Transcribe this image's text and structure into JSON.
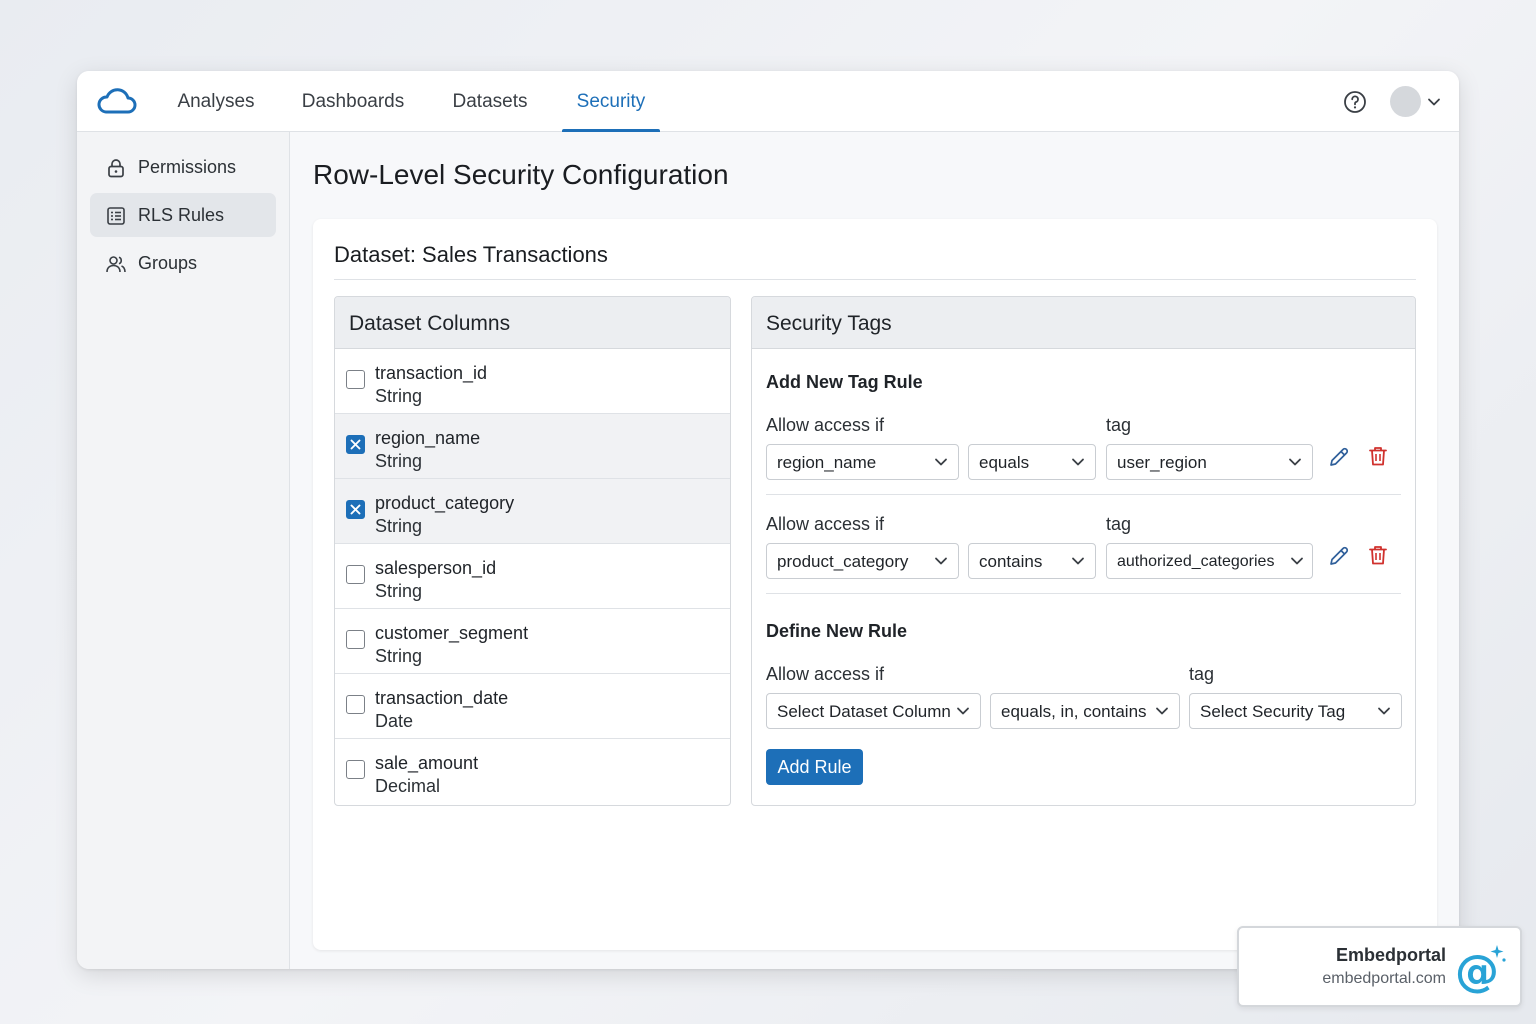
{
  "nav": {
    "tabs": [
      {
        "label": "Analyses"
      },
      {
        "label": "Dashboards"
      },
      {
        "label": "Datasets"
      },
      {
        "label": "Security",
        "active": true
      }
    ]
  },
  "sidebar": {
    "items": [
      {
        "label": "Permissions",
        "icon": "lock-icon"
      },
      {
        "label": "RLS Rules",
        "icon": "list-icon",
        "active": true
      },
      {
        "label": "Groups",
        "icon": "users-icon"
      }
    ]
  },
  "page": {
    "title": "Row-Level Security Configuration",
    "dataset_title": "Dataset: Sales Transactions"
  },
  "columns_panel": {
    "title": "Dataset Columns",
    "columns": [
      {
        "name": "transaction_id",
        "type": "String",
        "checked": false
      },
      {
        "name": "region_name",
        "type": "String",
        "checked": true
      },
      {
        "name": "product_category",
        "type": "String",
        "checked": true
      },
      {
        "name": "salesperson_id",
        "type": "String",
        "checked": false
      },
      {
        "name": "customer_segment",
        "type": "String",
        "checked": false
      },
      {
        "name": "transaction_date",
        "type": "Date",
        "checked": false
      },
      {
        "name": "sale_amount",
        "type": "Decimal",
        "checked": false
      }
    ]
  },
  "tags_panel": {
    "title": "Security Tags",
    "add_heading": "Add New Tag Rule",
    "rules": [
      {
        "allow_label": "Allow access if",
        "tag_label": "tag",
        "column": "region_name",
        "operator": "equals",
        "tag": "user_region"
      },
      {
        "allow_label": "Allow access if",
        "tag_label": "tag",
        "column": "product_category",
        "operator": "contains",
        "tag": "authorized_categories"
      }
    ],
    "define_heading": "Define New Rule",
    "new_rule": {
      "allow_label": "Allow access if",
      "tag_label": "tag",
      "column_placeholder": "Select Dataset Column",
      "operator_placeholder": "equals, in, contains",
      "tag_placeholder": "Select Security Tag"
    },
    "add_button": "Add Rule"
  },
  "badge": {
    "name": "Embedportal",
    "url": "embedportal.com"
  },
  "colors": {
    "accent": "#1d6fb8",
    "danger": "#d0312d"
  }
}
